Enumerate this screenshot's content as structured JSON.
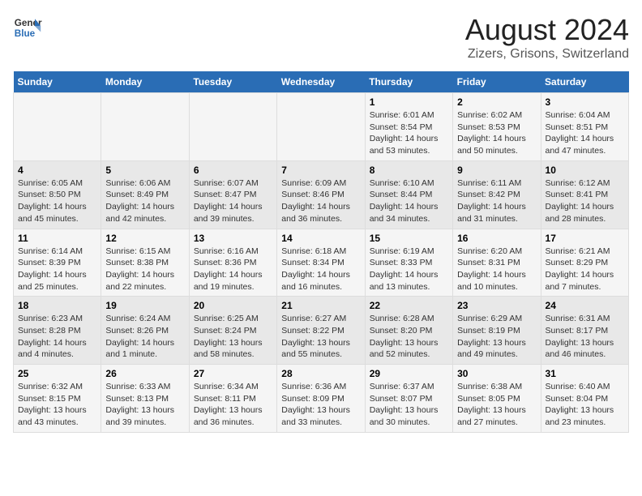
{
  "header": {
    "logo_line1": "General",
    "logo_line2": "Blue",
    "title": "August 2024",
    "subtitle": "Zizers, Grisons, Switzerland"
  },
  "weekdays": [
    "Sunday",
    "Monday",
    "Tuesday",
    "Wednesday",
    "Thursday",
    "Friday",
    "Saturday"
  ],
  "weeks": [
    [
      {
        "day": "",
        "info": ""
      },
      {
        "day": "",
        "info": ""
      },
      {
        "day": "",
        "info": ""
      },
      {
        "day": "",
        "info": ""
      },
      {
        "day": "1",
        "info": "Sunrise: 6:01 AM\nSunset: 8:54 PM\nDaylight: 14 hours\nand 53 minutes."
      },
      {
        "day": "2",
        "info": "Sunrise: 6:02 AM\nSunset: 8:53 PM\nDaylight: 14 hours\nand 50 minutes."
      },
      {
        "day": "3",
        "info": "Sunrise: 6:04 AM\nSunset: 8:51 PM\nDaylight: 14 hours\nand 47 minutes."
      }
    ],
    [
      {
        "day": "4",
        "info": "Sunrise: 6:05 AM\nSunset: 8:50 PM\nDaylight: 14 hours\nand 45 minutes."
      },
      {
        "day": "5",
        "info": "Sunrise: 6:06 AM\nSunset: 8:49 PM\nDaylight: 14 hours\nand 42 minutes."
      },
      {
        "day": "6",
        "info": "Sunrise: 6:07 AM\nSunset: 8:47 PM\nDaylight: 14 hours\nand 39 minutes."
      },
      {
        "day": "7",
        "info": "Sunrise: 6:09 AM\nSunset: 8:46 PM\nDaylight: 14 hours\nand 36 minutes."
      },
      {
        "day": "8",
        "info": "Sunrise: 6:10 AM\nSunset: 8:44 PM\nDaylight: 14 hours\nand 34 minutes."
      },
      {
        "day": "9",
        "info": "Sunrise: 6:11 AM\nSunset: 8:42 PM\nDaylight: 14 hours\nand 31 minutes."
      },
      {
        "day": "10",
        "info": "Sunrise: 6:12 AM\nSunset: 8:41 PM\nDaylight: 14 hours\nand 28 minutes."
      }
    ],
    [
      {
        "day": "11",
        "info": "Sunrise: 6:14 AM\nSunset: 8:39 PM\nDaylight: 14 hours\nand 25 minutes."
      },
      {
        "day": "12",
        "info": "Sunrise: 6:15 AM\nSunset: 8:38 PM\nDaylight: 14 hours\nand 22 minutes."
      },
      {
        "day": "13",
        "info": "Sunrise: 6:16 AM\nSunset: 8:36 PM\nDaylight: 14 hours\nand 19 minutes."
      },
      {
        "day": "14",
        "info": "Sunrise: 6:18 AM\nSunset: 8:34 PM\nDaylight: 14 hours\nand 16 minutes."
      },
      {
        "day": "15",
        "info": "Sunrise: 6:19 AM\nSunset: 8:33 PM\nDaylight: 14 hours\nand 13 minutes."
      },
      {
        "day": "16",
        "info": "Sunrise: 6:20 AM\nSunset: 8:31 PM\nDaylight: 14 hours\nand 10 minutes."
      },
      {
        "day": "17",
        "info": "Sunrise: 6:21 AM\nSunset: 8:29 PM\nDaylight: 14 hours\nand 7 minutes."
      }
    ],
    [
      {
        "day": "18",
        "info": "Sunrise: 6:23 AM\nSunset: 8:28 PM\nDaylight: 14 hours\nand 4 minutes."
      },
      {
        "day": "19",
        "info": "Sunrise: 6:24 AM\nSunset: 8:26 PM\nDaylight: 14 hours\nand 1 minute."
      },
      {
        "day": "20",
        "info": "Sunrise: 6:25 AM\nSunset: 8:24 PM\nDaylight: 13 hours\nand 58 minutes."
      },
      {
        "day": "21",
        "info": "Sunrise: 6:27 AM\nSunset: 8:22 PM\nDaylight: 13 hours\nand 55 minutes."
      },
      {
        "day": "22",
        "info": "Sunrise: 6:28 AM\nSunset: 8:20 PM\nDaylight: 13 hours\nand 52 minutes."
      },
      {
        "day": "23",
        "info": "Sunrise: 6:29 AM\nSunset: 8:19 PM\nDaylight: 13 hours\nand 49 minutes."
      },
      {
        "day": "24",
        "info": "Sunrise: 6:31 AM\nSunset: 8:17 PM\nDaylight: 13 hours\nand 46 minutes."
      }
    ],
    [
      {
        "day": "25",
        "info": "Sunrise: 6:32 AM\nSunset: 8:15 PM\nDaylight: 13 hours\nand 43 minutes."
      },
      {
        "day": "26",
        "info": "Sunrise: 6:33 AM\nSunset: 8:13 PM\nDaylight: 13 hours\nand 39 minutes."
      },
      {
        "day": "27",
        "info": "Sunrise: 6:34 AM\nSunset: 8:11 PM\nDaylight: 13 hours\nand 36 minutes."
      },
      {
        "day": "28",
        "info": "Sunrise: 6:36 AM\nSunset: 8:09 PM\nDaylight: 13 hours\nand 33 minutes."
      },
      {
        "day": "29",
        "info": "Sunrise: 6:37 AM\nSunset: 8:07 PM\nDaylight: 13 hours\nand 30 minutes."
      },
      {
        "day": "30",
        "info": "Sunrise: 6:38 AM\nSunset: 8:05 PM\nDaylight: 13 hours\nand 27 minutes."
      },
      {
        "day": "31",
        "info": "Sunrise: 6:40 AM\nSunset: 8:04 PM\nDaylight: 13 hours\nand 23 minutes."
      }
    ]
  ]
}
